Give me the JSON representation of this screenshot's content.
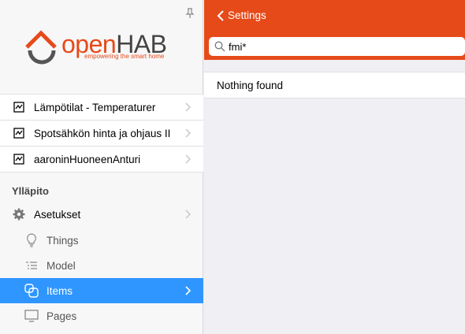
{
  "logo": {
    "part1": "open",
    "part2": "HAB",
    "tagline": "empowering the smart home"
  },
  "widgets": [
    {
      "label": "Lämpötilat - Temperaturer"
    },
    {
      "label": "Spotsähkön hinta ja ohjaus II"
    },
    {
      "label": "aaroninHuoneenAnturi"
    }
  ],
  "section_title": "Ylläpito",
  "menu": {
    "settings": "Asetukset",
    "things": "Things",
    "model": "Model",
    "items": "Items",
    "pages": "Pages"
  },
  "topbar": {
    "back_label": "Settings"
  },
  "search": {
    "value": "fmi*"
  },
  "result": {
    "message": "Nothing found"
  },
  "colors": {
    "brand": "#e64a19",
    "active": "#2f96ff"
  }
}
